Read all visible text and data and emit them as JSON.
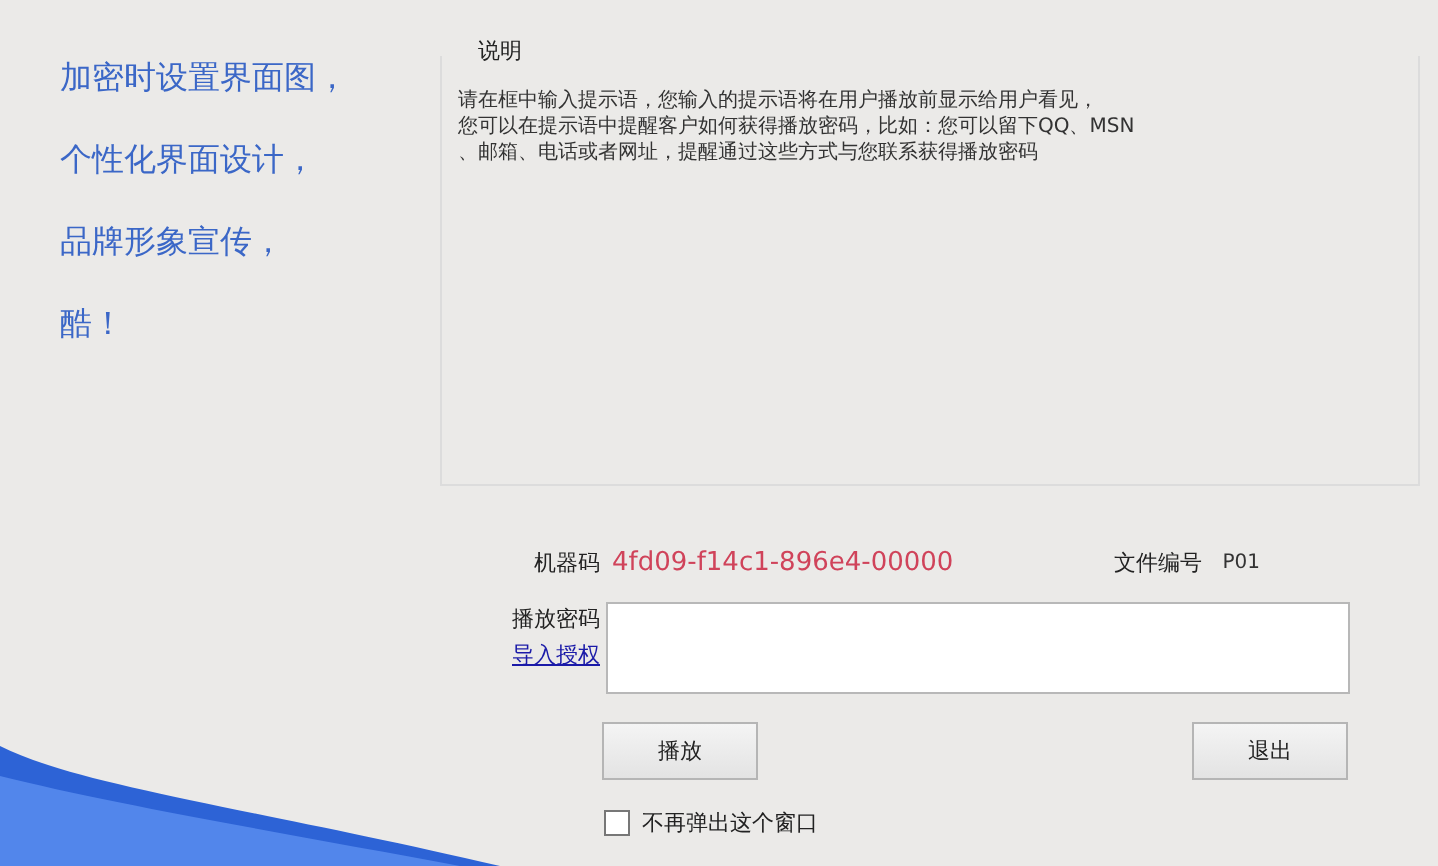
{
  "slogans": [
    "加密时设置界面图，",
    "个性化界面设计，",
    "品牌形象宣传，",
    "酷！"
  ],
  "notice": {
    "title": "说明",
    "lines": [
      "请在框中输入提示语，您输入的提示语将在用户播放前显示给用户看见，",
      "您可以在提示语中提醒客户如何获得播放密码，比如：您可以留下QQ、MSN",
      "、邮箱、电话或者网址，提醒通过这些方式与您联系获得播放密码"
    ]
  },
  "machine_code": {
    "label": "机器码",
    "value": "4fd09-f14c1-896e4-00000"
  },
  "file_number": {
    "label": "文件编号",
    "value": "P01"
  },
  "password": {
    "label": "播放密码",
    "link": "导入授权"
  },
  "buttons": [
    "播放",
    "退出"
  ],
  "dont_show_again": {
    "label": "不再弹出这个窗口",
    "checked": false
  }
}
